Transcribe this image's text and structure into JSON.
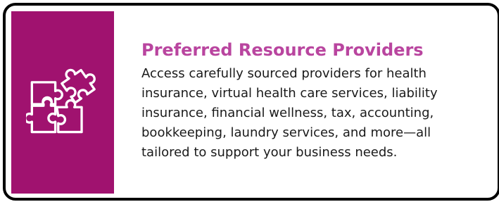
{
  "card": {
    "title": "Preferred Resource Providers",
    "description": "Access carefully sourced providers for health insurance, virtual health care services, liability insurance, financial wellness, tax, accounting, bookkeeping, laundry services, and more—all tailored to support your business needs.",
    "icon": "puzzle-pieces-icon"
  },
  "colors": {
    "panel": "#a0126f",
    "title": "#b9459f",
    "border": "#000000"
  }
}
